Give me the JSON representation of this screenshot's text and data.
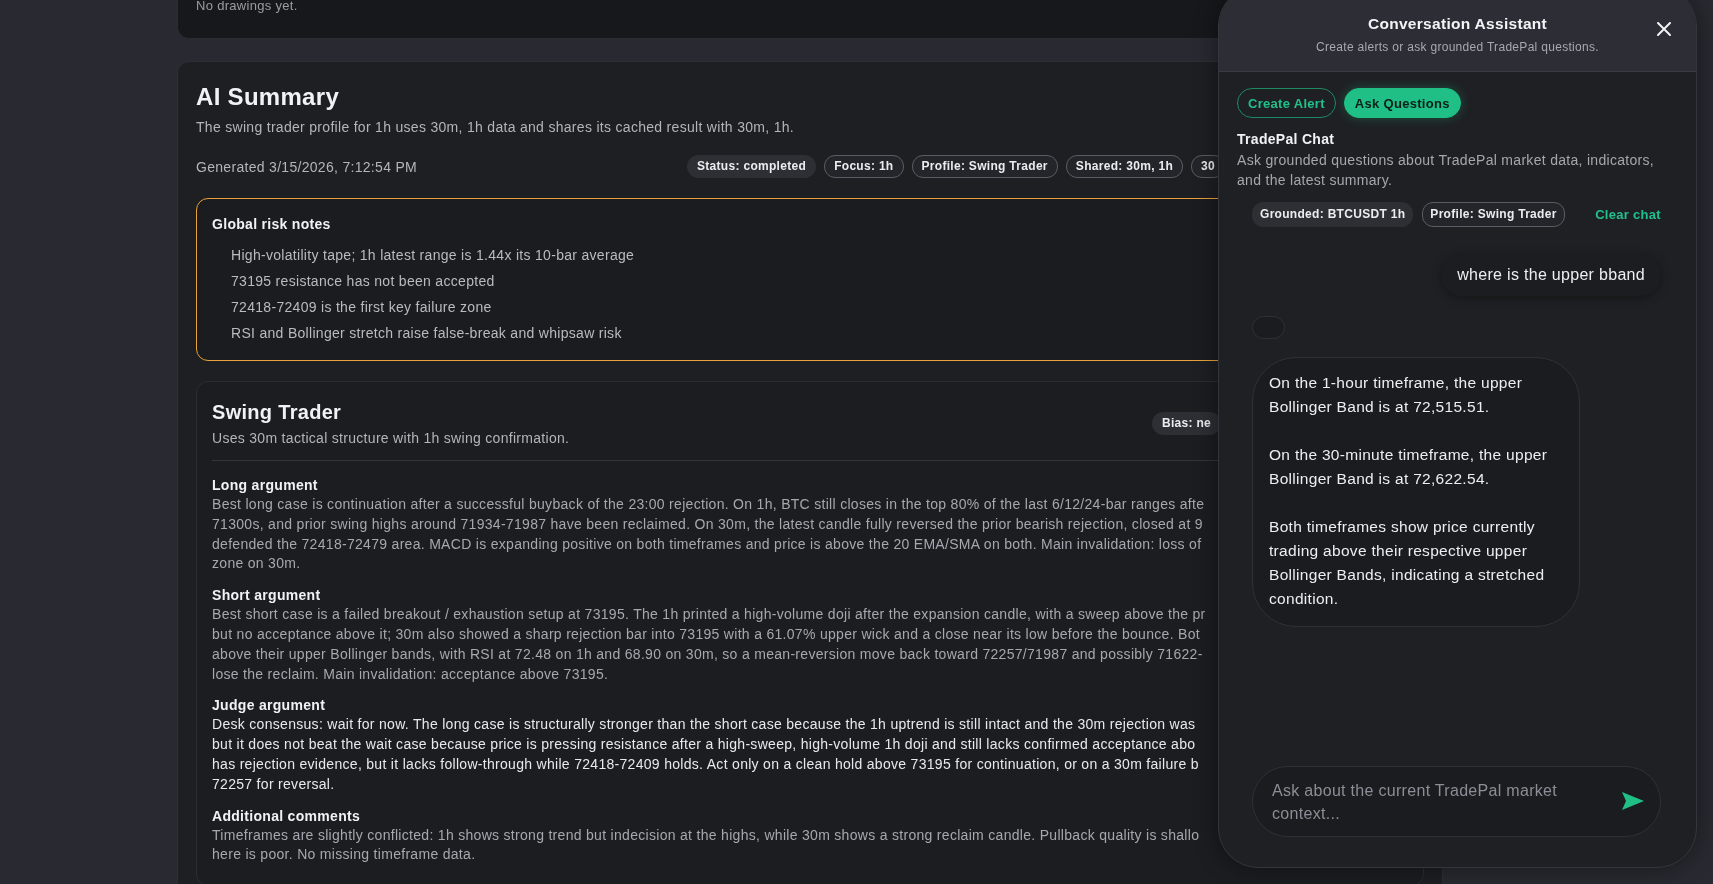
{
  "drawings": {
    "message": "No drawings yet."
  },
  "summary": {
    "title": "AI Summary",
    "description": "The swing trader profile for 1h uses 30m, 1h data and shares its cached result with 30m, 1h.",
    "generated": "Generated 3/15/2026, 7:12:54 PM",
    "badges": [
      {
        "text": "Status: completed",
        "kind": "solid"
      },
      {
        "text": "Focus: 1h",
        "kind": "outline"
      },
      {
        "text": "Profile: Swing Trader",
        "kind": "outline"
      },
      {
        "text": "Shared: 30m, 1h",
        "kind": "outline"
      },
      {
        "text": "30",
        "kind": "outline"
      }
    ],
    "risk_notes": {
      "title": "Global risk notes",
      "items": [
        "High-volatility tape; 1h latest range is 1.44x its 10-bar average",
        "73195 resistance has not been accepted",
        "72418-72409 is the first key failure zone",
        "RSI and Bollinger stretch raise false-break and whipsaw risk"
      ]
    },
    "profile_card": {
      "title": "Swing Trader",
      "description": "Uses 30m tactical structure with 1h swing confirmation.",
      "badge": {
        "text": "Bias: ne",
        "kind": "solid"
      },
      "sections": [
        {
          "heading": "Long argument",
          "emphasized": false,
          "lines": [
            "Best long case is continuation after a successful buyback of the 23:00 rejection. On 1h, BTC still closes in the top 80% of the last 6/12/24-bar ranges afte",
            "71300s, and prior swing highs around 71934-71987 have been reclaimed. On 30m, the latest candle fully reversed the prior bearish rejection, closed at 9",
            "defended the 72418-72479 area. MACD is expanding positive on both timeframes and price is above the 20 EMA/SMA on both. Main invalidation: loss of",
            "zone on 30m."
          ]
        },
        {
          "heading": "Short argument",
          "emphasized": false,
          "lines": [
            "Best short case is a failed breakout / exhaustion setup at 73195. The 1h printed a high-volume doji after the expansion candle, with a sweep above the pr",
            "but no acceptance above it; 30m also showed a sharp rejection bar into 73195 with a 61.07% upper wick and a close near its low before the bounce. Bot",
            "above their upper Bollinger bands, with RSI at 72.48 on 1h and 68.90 on 30m, so a mean-reversion move back toward 72257/71987 and possibly 71622-",
            "lose the reclaim. Main invalidation: acceptance above 73195."
          ]
        },
        {
          "heading": "Judge argument",
          "emphasized": true,
          "lines": [
            "Desk consensus: wait for now. The long case is structurally stronger than the short case because the 1h uptrend is still intact and the 30m rejection was",
            "but it does not beat the wait case because price is pressing resistance after a high-sweep, high-volume 1h doji and still lacks confirmed acceptance abo",
            "has rejection evidence, but it lacks follow-through while 72418-72409 holds. Act only on a clean hold above 73195 for continuation, or on a 30m failure b",
            "72257 for reversal."
          ]
        },
        {
          "heading": "Additional comments",
          "emphasized": false,
          "lines": [
            "Timeframes are slightly conflicted: 1h shows strong trend but indecision at the highs, while 30m shows a strong reclaim candle. Pullback quality is shallo",
            "here is poor. No missing timeframe data."
          ]
        }
      ]
    }
  },
  "assistant_panel": {
    "title": "Conversation Assistant",
    "subtitle": "Create alerts or ask grounded TradePal questions.",
    "modes": [
      {
        "label": "Create Alert",
        "selected": false
      },
      {
        "label": "Ask Questions",
        "selected": true
      }
    ],
    "chat": {
      "title": "TradePal Chat",
      "description": "Ask grounded questions about TradePal market data, indicators, and the latest summary.",
      "chips": [
        {
          "text": "Grounded: BTCUSDT 1h",
          "kind": "solid"
        },
        {
          "text": "Profile: Swing Trader",
          "kind": "outline"
        }
      ],
      "clear_label": "Clear chat",
      "messages": [
        {
          "kind": "user",
          "text": "where is the upper bband"
        },
        {
          "kind": "pending"
        },
        {
          "kind": "assistant",
          "paragraphs": [
            "On the 1-hour timeframe, the upper Bollinger Band is at 72,515.51.",
            "On the 30-minute timeframe, the upper Bollinger Band is at 72,622.54.",
            "Both timeframes show price currently trading above their respective upper Bollinger Bands, indicating a stretched condition."
          ]
        }
      ],
      "input": {
        "placeholder": "Ask about the current TradePal market context..."
      }
    }
  }
}
